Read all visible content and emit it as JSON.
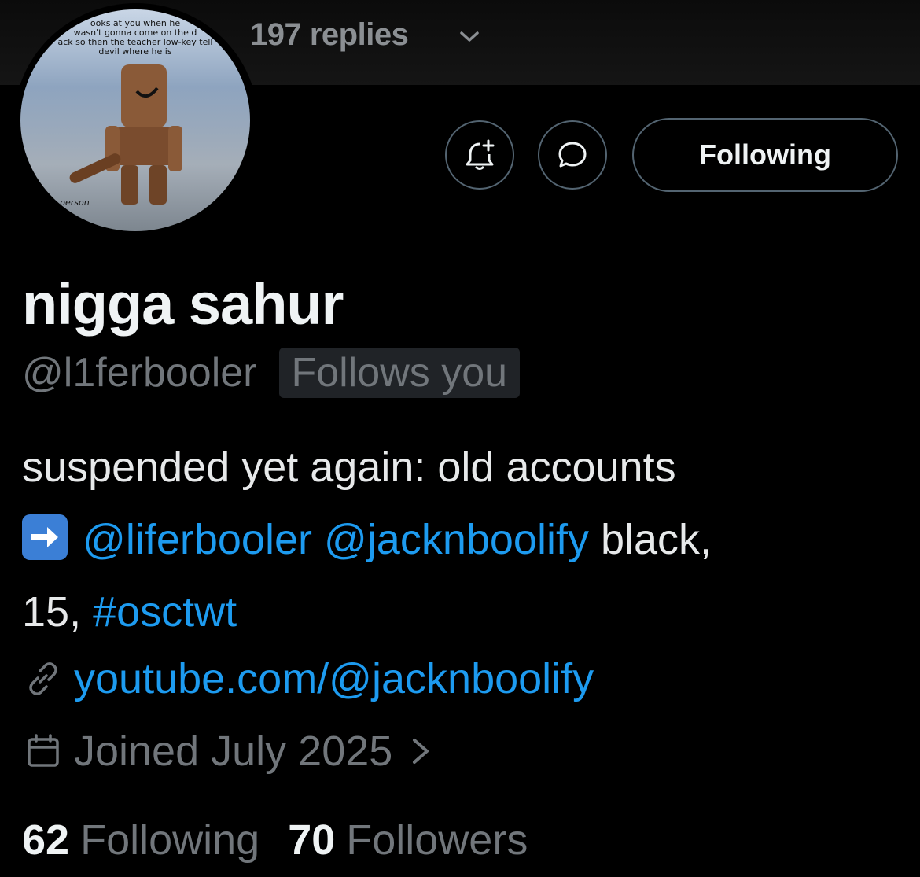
{
  "banner": {
    "replies_text": "197 replies"
  },
  "avatar": {
    "caption_top": [
      "ooks at you when he",
      "wasn't gonna come on the d",
      "ack so then the teacher low-key tell",
      "devil where he is"
    ],
    "caption_bottom": "person"
  },
  "actions": {
    "notify_icon": "bell-plus-icon",
    "message_icon": "chat-bubble-icon",
    "follow_label": "Following"
  },
  "profile": {
    "display_name": "nigga sahur",
    "handle": "@l1ferbooler",
    "follows_you": "Follows you"
  },
  "bio": {
    "line1": "suspended yet again: old accounts",
    "mention1": "@liferbooler",
    "mention2": "@jacknboolify",
    "after_mentions": " black,",
    "line3_prefix": "15, ",
    "hashtag": "#osctwt"
  },
  "link": {
    "text": "youtube.com/@jacknboolify",
    "icon": "link-icon"
  },
  "joined": {
    "text": "Joined July 2025",
    "icon": "calendar-icon"
  },
  "stats": {
    "following_count": "62",
    "following_label": "Following",
    "followers_count": "70",
    "followers_label": "Followers"
  },
  "colors": {
    "accent": "#1d9bf0",
    "muted": "#71767b",
    "background": "#000000"
  }
}
